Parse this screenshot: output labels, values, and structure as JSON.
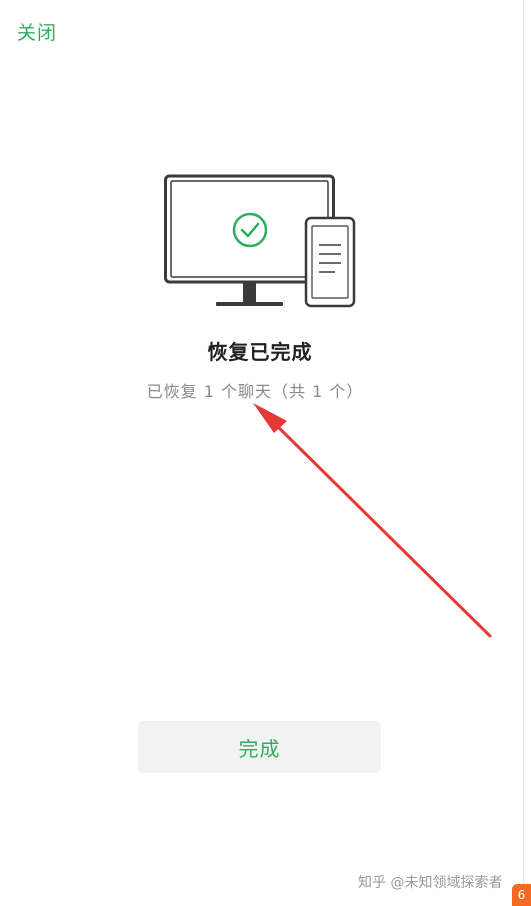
{
  "header": {
    "close_label": "关闭"
  },
  "result": {
    "icon": "check-circle-icon",
    "title": "恢复已完成",
    "subtitle": "已恢复 1 个聊天（共 1 个）"
  },
  "actions": {
    "done_label": "完成"
  },
  "watermark": {
    "text": "知乎 @未知领域探索者"
  },
  "colors": {
    "accent": "#2fae62",
    "annotation_arrow": "#e53935",
    "button_bg": "#f2f2f2"
  }
}
